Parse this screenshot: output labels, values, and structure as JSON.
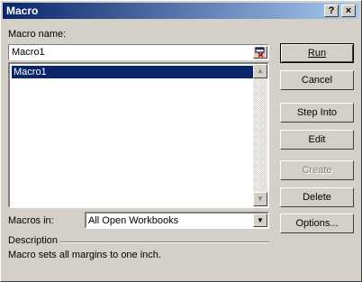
{
  "window": {
    "title": "Macro",
    "help_label": "?",
    "close_label": "×"
  },
  "macro_name": {
    "label": "Macro name:",
    "value": "Macro1"
  },
  "macro_list": {
    "items": [
      "Macro1"
    ],
    "selected_index": 0
  },
  "buttons": {
    "run": "Run",
    "cancel": "Cancel",
    "step_into": "Step Into",
    "edit": "Edit",
    "create": "Create",
    "delete": "Delete",
    "options": "Options..."
  },
  "macros_in": {
    "label": "Macros in:",
    "selected": "All Open Workbooks"
  },
  "description": {
    "label": "Description",
    "text": "Macro sets all margins to one inch."
  },
  "icons": {
    "collapse": "collapse-dialog-icon",
    "scroll_up": "scroll-up-arrow-icon",
    "scroll_down": "scroll-down-arrow-icon",
    "dropdown": "dropdown-arrow-icon"
  }
}
